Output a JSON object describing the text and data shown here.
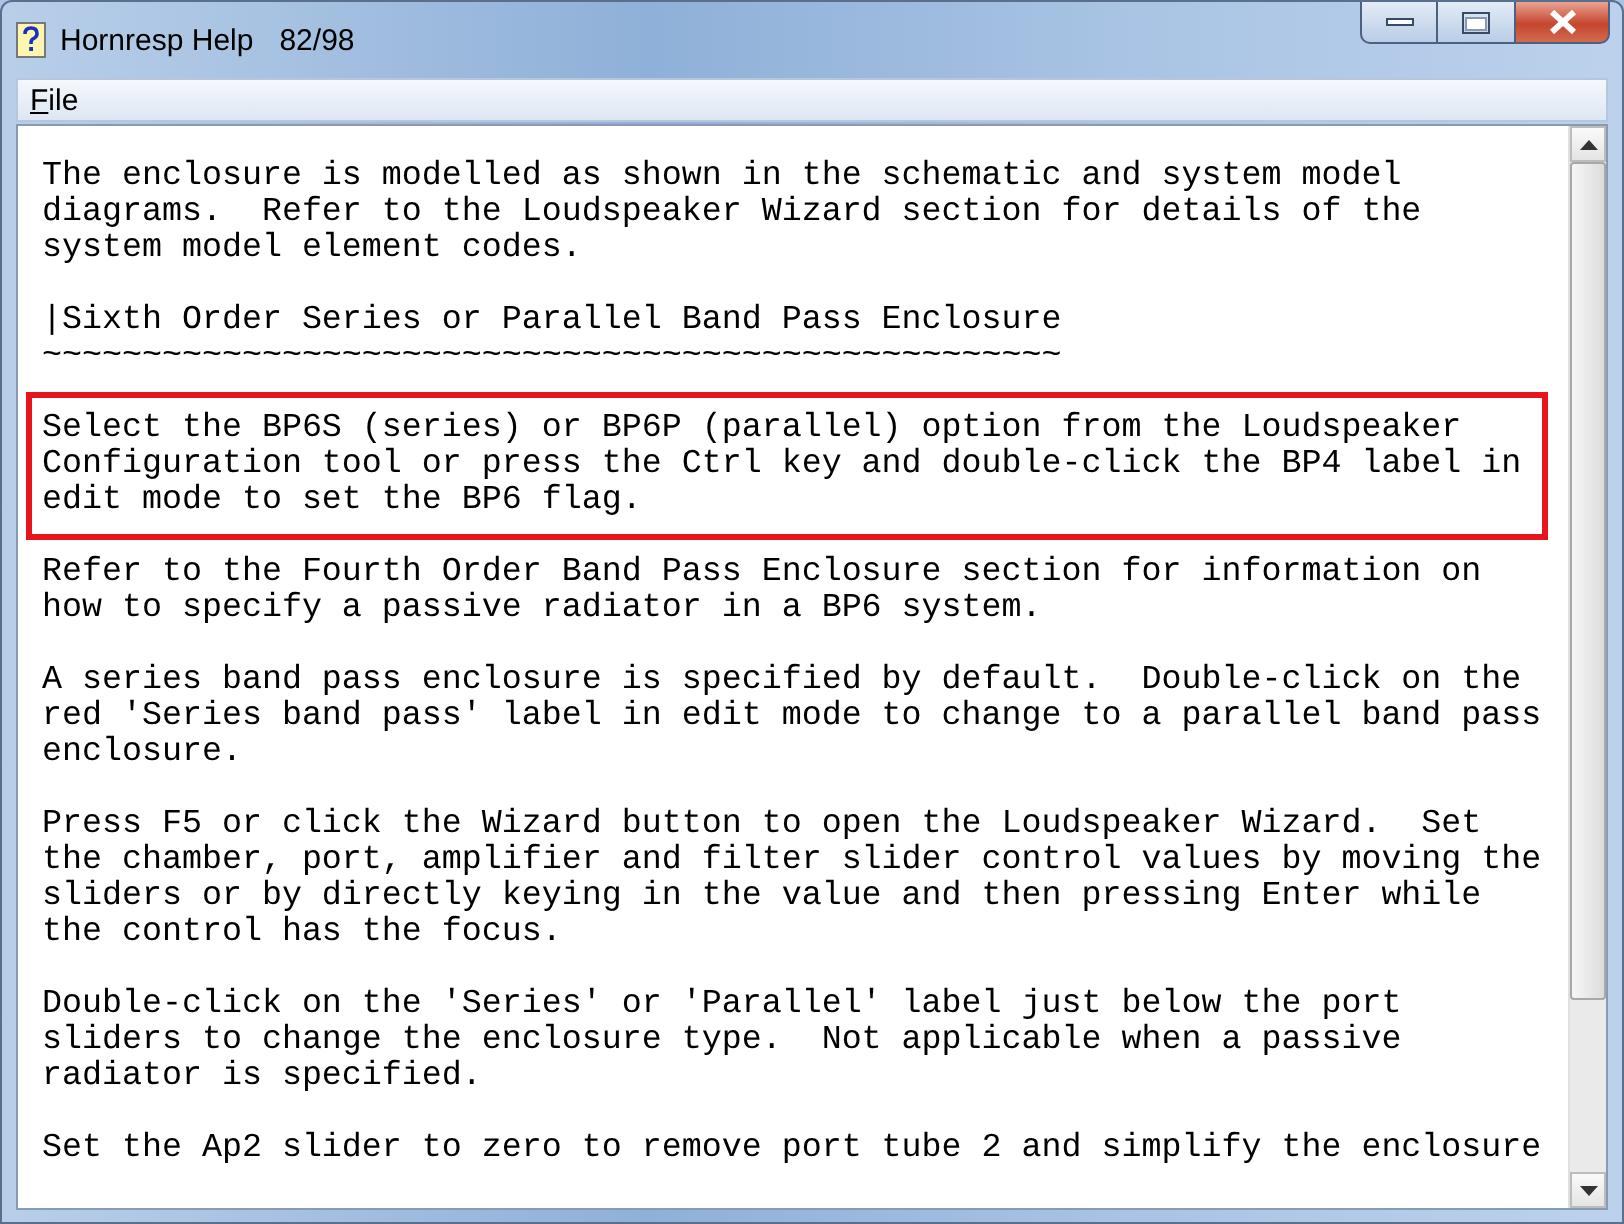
{
  "window": {
    "title": "Hornresp Help",
    "page": "82/98"
  },
  "menu": [
    {
      "label": "File"
    }
  ],
  "paragraphs": [
    {
      "text": "The enclosure is modelled as shown in the schematic and system model\ndiagrams.  Refer to the Loudspeaker Wizard section for details of the\nsystem model element codes.",
      "boxed": false
    },
    {
      "text": "|Sixth Order Series or Parallel Band Pass Enclosure\n~~~~~~~~~~~~~~~~~~~~~~~~~~~~~~~~~~~~~~~~~~~~~~~~~~~",
      "boxed": false
    },
    {
      "text": "Select the BP6S (series) or BP6P (parallel) option from the Loudspeaker\nConfiguration tool or press the Ctrl key and double-click the BP4 label in\nedit mode to set the BP6 flag.",
      "boxed": true
    },
    {
      "text": "Refer to the Fourth Order Band Pass Enclosure section for information on\nhow to specify a passive radiator in a BP6 system.",
      "boxed": false
    },
    {
      "text": "A series band pass enclosure is specified by default.  Double-click on the\nred 'Series band pass' label in edit mode to change to a parallel band pass\nenclosure.",
      "boxed": false
    },
    {
      "text": "Press F5 or click the Wizard button to open the Loudspeaker Wizard.  Set\nthe chamber, port, amplifier and filter slider control values by moving the\nsliders or by directly keying in the value and then pressing Enter while\nthe control has the focus.",
      "boxed": false
    },
    {
      "text": "Double-click on the 'Series' or 'Parallel' label just below the port\nsliders to change the enclosure type.  Not applicable when a passive\nradiator is specified.",
      "boxed": false
    },
    {
      "text": "Set the Ap2 slider to zero to remove port tube 2 and simplify the enclosure",
      "boxed": false
    }
  ]
}
